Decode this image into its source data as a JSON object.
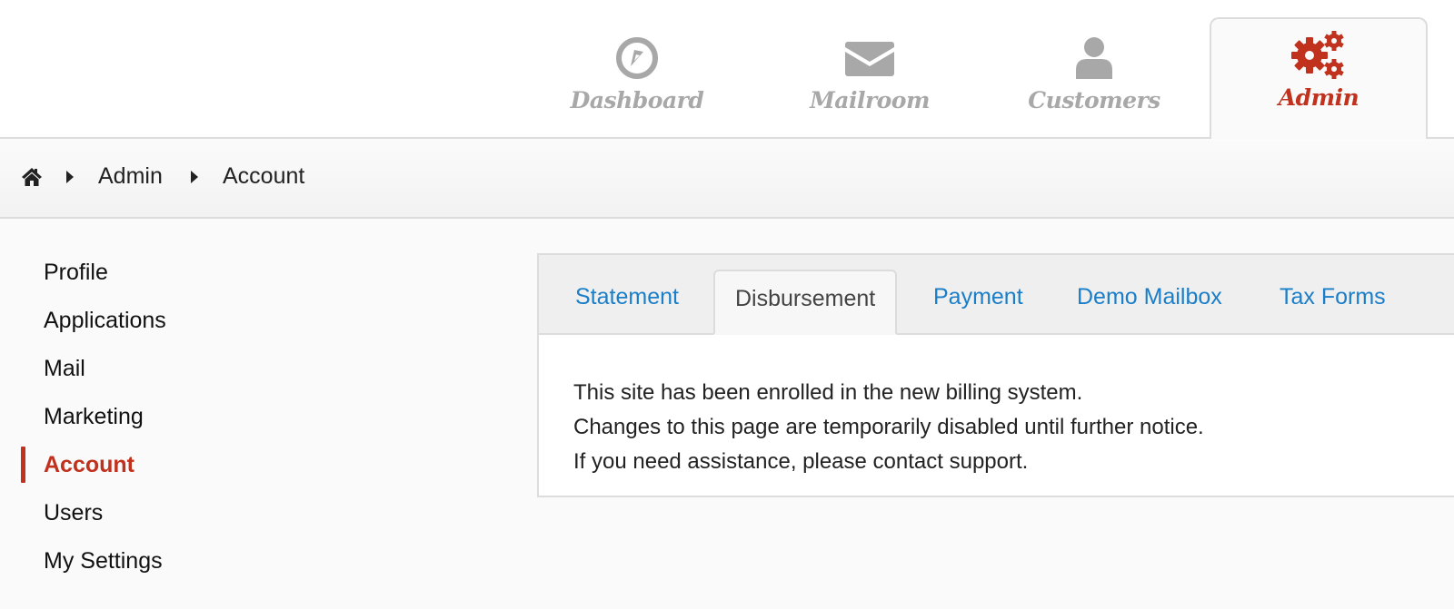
{
  "top_nav": {
    "items": [
      {
        "label": "Dashboard",
        "icon": "compass-icon",
        "active": false
      },
      {
        "label": "Mailroom",
        "icon": "envelope-icon",
        "active": false
      },
      {
        "label": "Customers",
        "icon": "user-icon",
        "active": false
      },
      {
        "label": "Admin",
        "icon": "gears-icon",
        "active": true
      }
    ]
  },
  "breadcrumb": {
    "home_icon": "home-icon",
    "separator_icon": "caret-right-icon",
    "items": [
      "Admin",
      "Account"
    ]
  },
  "sidebar": {
    "items": [
      {
        "label": "Profile"
      },
      {
        "label": "Applications"
      },
      {
        "label": "Mail"
      },
      {
        "label": "Marketing"
      },
      {
        "label": "Account",
        "active": true
      },
      {
        "label": "Users"
      },
      {
        "label": "My Settings"
      }
    ]
  },
  "tabs": {
    "items": [
      {
        "label": "Statement"
      },
      {
        "label": "Disbursement",
        "active": true
      },
      {
        "label": "Payment"
      },
      {
        "label": "Demo Mailbox"
      },
      {
        "label": "Tax Forms"
      }
    ]
  },
  "notice": {
    "lines": [
      "This site has been enrolled in the new billing system.",
      "Changes to this page are temporarily disabled until further notice.",
      "If you need assistance, please contact support."
    ]
  },
  "colors": {
    "accent": "#c0321e",
    "link": "#1a7ec8",
    "inactive_nav": "#a8a8a8"
  }
}
